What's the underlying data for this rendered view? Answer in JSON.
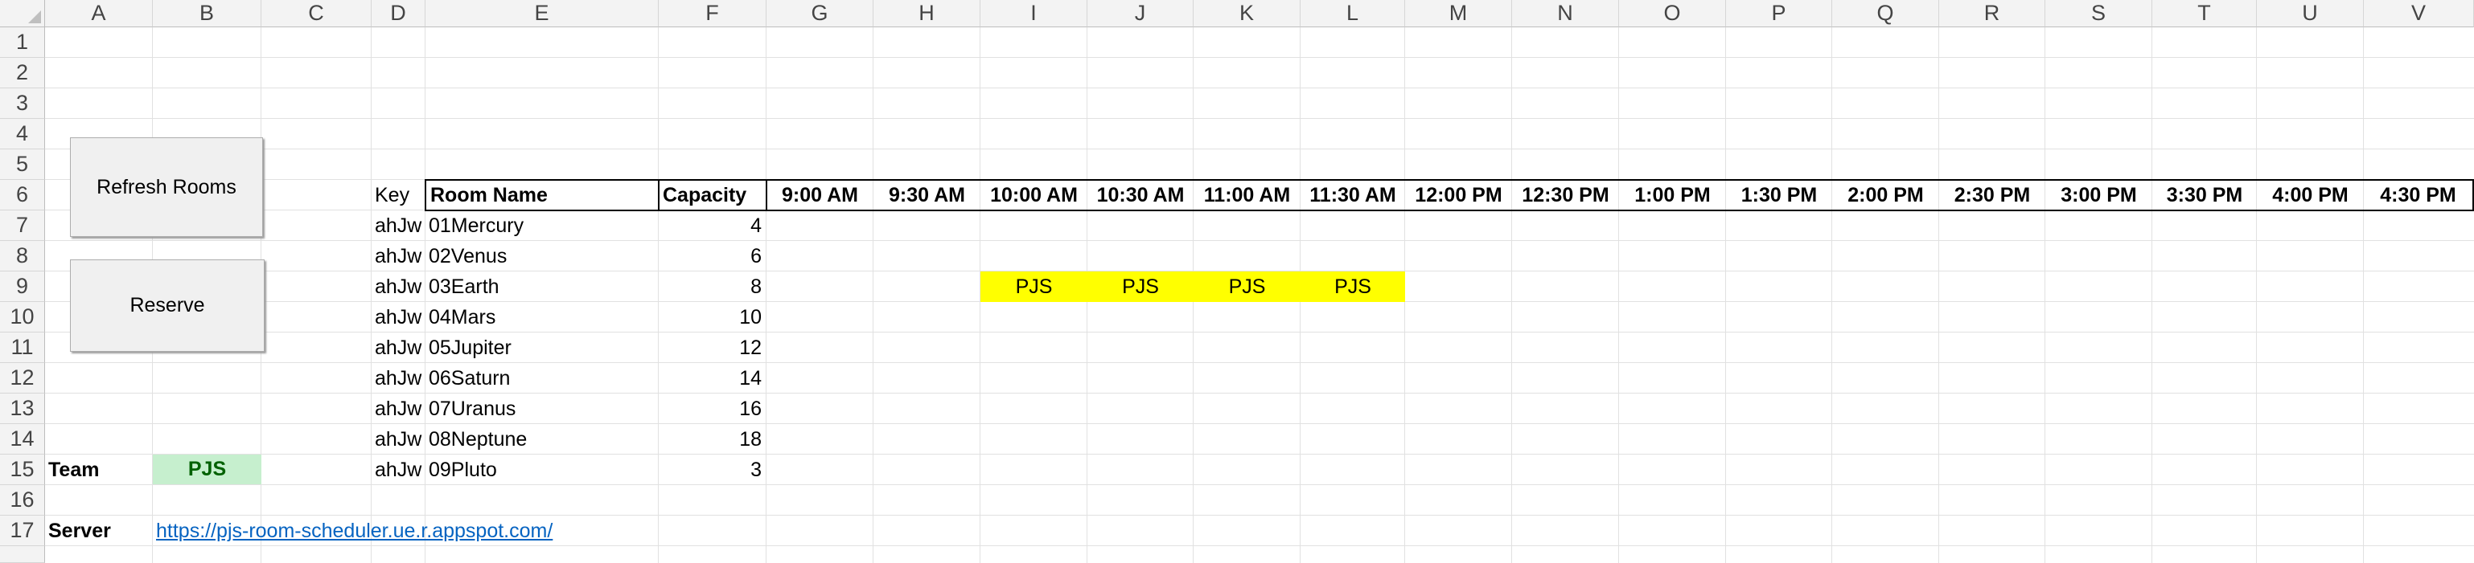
{
  "columns": [
    "A",
    "B",
    "C",
    "D",
    "E",
    "F",
    "G",
    "H",
    "I",
    "J",
    "K",
    "L",
    "M",
    "N",
    "O",
    "P",
    "Q",
    "R",
    "S",
    "T",
    "U",
    "V"
  ],
  "rows": [
    "1",
    "2",
    "3",
    "4",
    "5",
    "6",
    "7",
    "8",
    "9",
    "10",
    "11",
    "12",
    "13",
    "14",
    "15",
    "16",
    "17"
  ],
  "buttons": {
    "refresh": "Refresh Rooms",
    "reserve": "Reserve"
  },
  "table": {
    "headers": {
      "key": "Key",
      "room_name": "Room Name",
      "capacity": "Capacity"
    },
    "times": [
      "9:00 AM",
      "9:30 AM",
      "10:00 AM",
      "10:30 AM",
      "11:00 AM",
      "11:30 AM",
      "12:00 PM",
      "12:30 PM",
      "1:00 PM",
      "1:30 PM",
      "2:00 PM",
      "2:30 PM",
      "3:00 PM",
      "3:30 PM",
      "4:00 PM",
      "4:30 PM"
    ],
    "rooms": [
      {
        "key": "ahJw",
        "name": "01Mercury",
        "capacity": "4"
      },
      {
        "key": "ahJw",
        "name": "02Venus",
        "capacity": "6"
      },
      {
        "key": "ahJw",
        "name": "03Earth",
        "capacity": "8"
      },
      {
        "key": "ahJw",
        "name": "04Mars",
        "capacity": "10"
      },
      {
        "key": "ahJw",
        "name": "05Jupiter",
        "capacity": "12"
      },
      {
        "key": "ahJw",
        "name": "06Saturn",
        "capacity": "14"
      },
      {
        "key": "ahJw",
        "name": "07Uranus",
        "capacity": "16"
      },
      {
        "key": "ahJw",
        "name": "08Neptune",
        "capacity": "18"
      },
      {
        "key": "ahJw",
        "name": "09Pluto",
        "capacity": "3"
      }
    ],
    "bookings": [
      "PJS",
      "PJS",
      "PJS",
      "PJS"
    ],
    "booking_color": "#ffff00"
  },
  "team": {
    "label": "Team",
    "value": "PJS",
    "fill_color": "#c6efce",
    "text_color": "#006100"
  },
  "server": {
    "label": "Server",
    "url": "https://pjs-room-scheduler.ue.r.appspot.com/"
  }
}
